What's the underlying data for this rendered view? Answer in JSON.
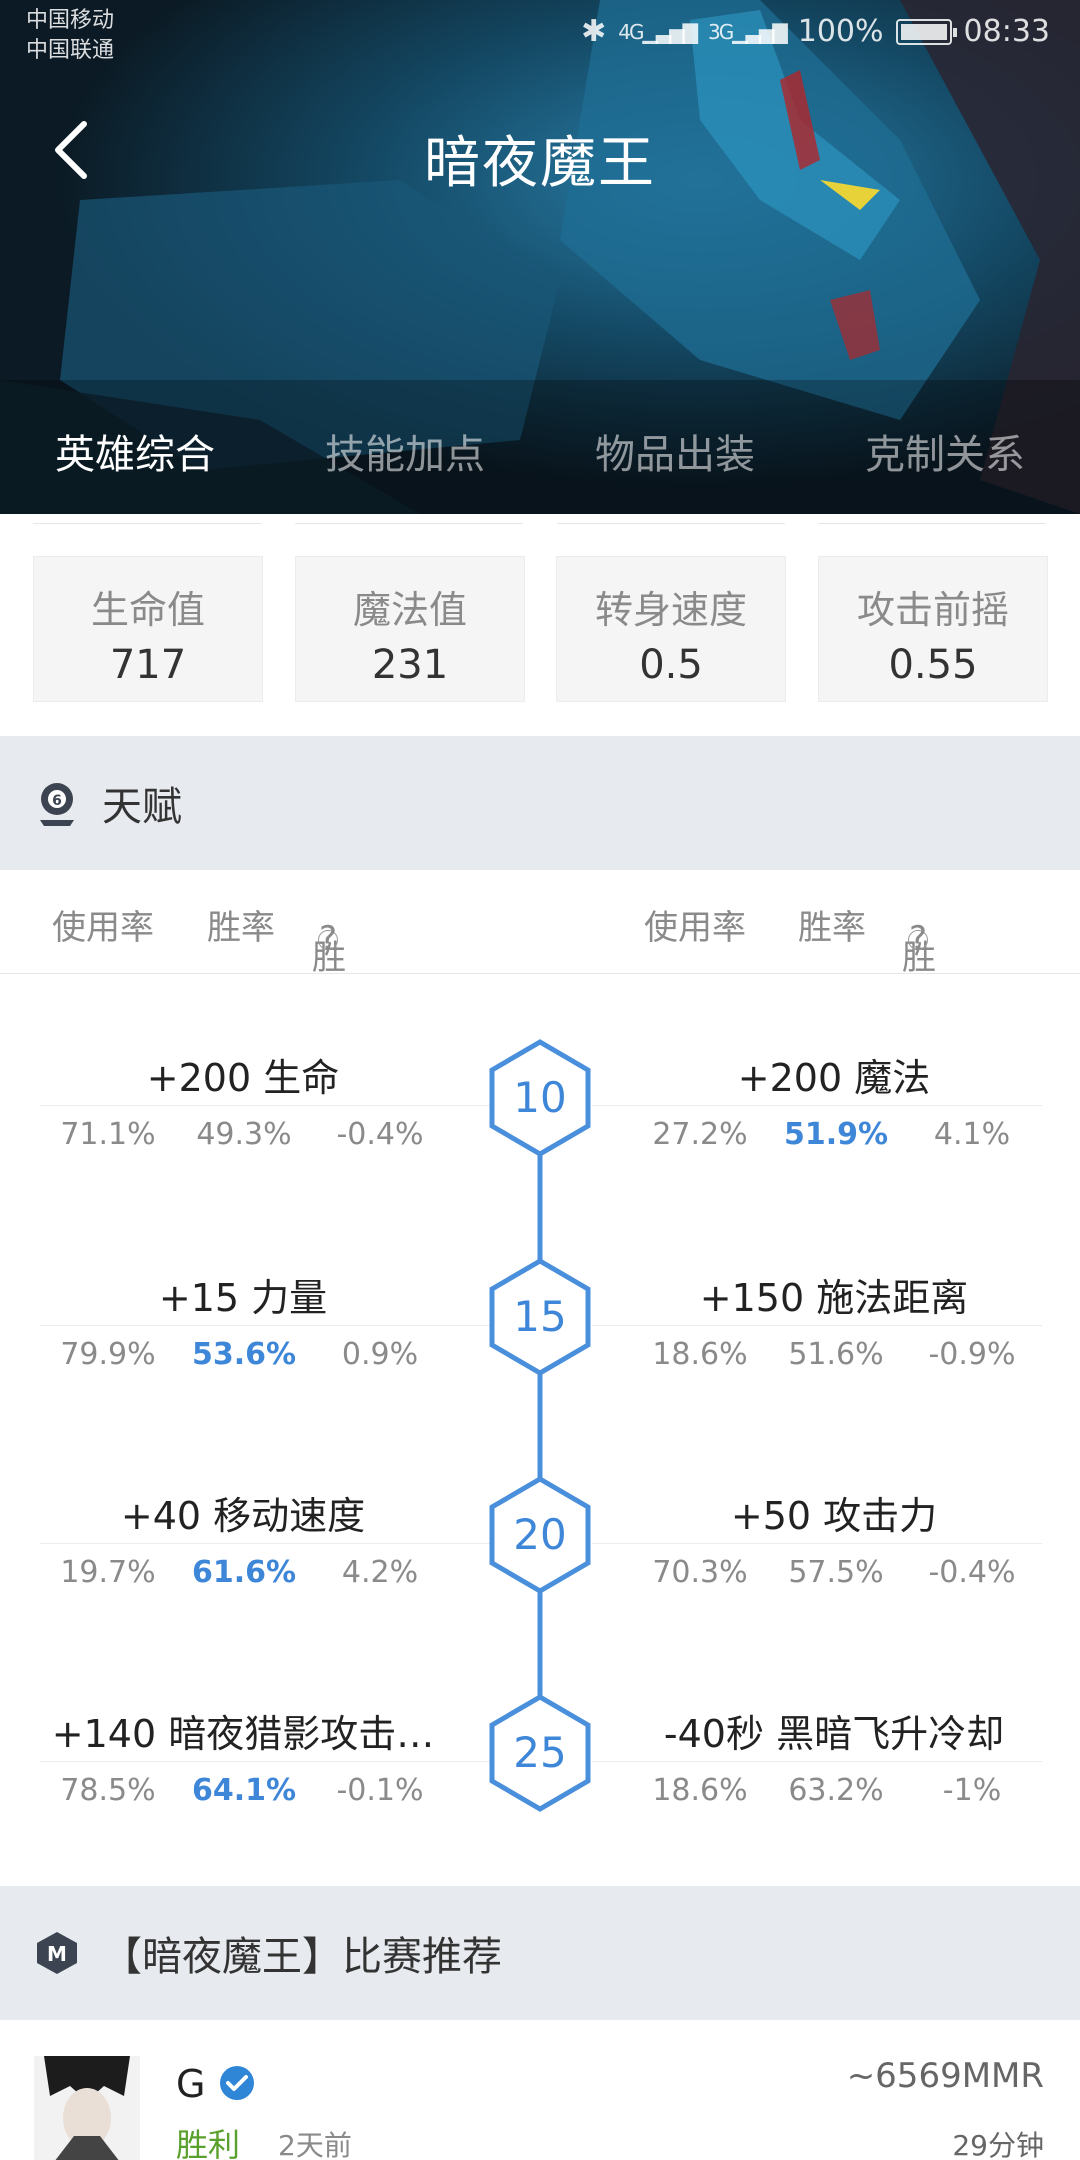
{
  "status_bar": {
    "carrier_1": "中国移动",
    "carrier_2": "中国联通",
    "network_1": "4G",
    "network_2": "3G",
    "battery": "100%",
    "time": "08:33"
  },
  "header": {
    "title": "暗夜魔王"
  },
  "tabs": [
    {
      "label": "英雄综合",
      "active": true
    },
    {
      "label": "技能加点",
      "active": false
    },
    {
      "label": "物品出装",
      "active": false
    },
    {
      "label": "克制关系",
      "active": false
    }
  ],
  "stats": [
    {
      "label": "生命值",
      "value": "717"
    },
    {
      "label": "魔法值",
      "value": "231"
    },
    {
      "label": "转身速度",
      "value": "0.5"
    },
    {
      "label": "攻击前摇",
      "value": "0.55"
    }
  ],
  "talents_section": {
    "title": "天赋",
    "icon": "talent-icon",
    "columns": {
      "usage": "使用率",
      "winrate": "胜率",
      "impact": "胜率影响",
      "help_glyph": "?"
    },
    "rows": [
      {
        "level": "10",
        "left": {
          "name": "+200 生命",
          "usage": "71.1%",
          "winrate": "49.3%",
          "impact": "-0.4%",
          "winrate_highlight": false
        },
        "right": {
          "name": "+200 魔法",
          "usage": "27.2%",
          "winrate": "51.9%",
          "impact": "4.1%",
          "winrate_highlight": true
        }
      },
      {
        "level": "15",
        "left": {
          "name": "+15 力量",
          "usage": "79.9%",
          "winrate": "53.6%",
          "impact": "0.9%",
          "winrate_highlight": true
        },
        "right": {
          "name": "+150 施法距离",
          "usage": "18.6%",
          "winrate": "51.6%",
          "impact": "-0.9%",
          "winrate_highlight": false
        }
      },
      {
        "level": "20",
        "left": {
          "name": "+40 移动速度",
          "usage": "19.7%",
          "winrate": "61.6%",
          "impact": "4.2%",
          "winrate_highlight": true
        },
        "right": {
          "name": "+50 攻击力",
          "usage": "70.3%",
          "winrate": "57.5%",
          "impact": "-0.4%",
          "winrate_highlight": false
        }
      },
      {
        "level": "25",
        "left": {
          "name": "+140 暗夜猎影攻击…",
          "usage": "78.5%",
          "winrate": "64.1%",
          "impact": "-0.1%",
          "winrate_highlight": true
        },
        "right": {
          "name": "-40秒 黑暗飞升冷却",
          "usage": "18.6%",
          "winrate": "63.2%",
          "impact": "-1%",
          "winrate_highlight": false
        }
      }
    ]
  },
  "match_section": {
    "title": "【暗夜魔王】比赛推荐",
    "icon": "m-logo-icon",
    "match": {
      "player": "G",
      "result": "胜利",
      "time_ago": "2天前",
      "mmr": "~6569MMR",
      "duration": "29分钟"
    }
  },
  "colors": {
    "accent_blue": "#3d86d8",
    "win_green": "#5aa02c",
    "section_bg": "#e7ebef"
  }
}
